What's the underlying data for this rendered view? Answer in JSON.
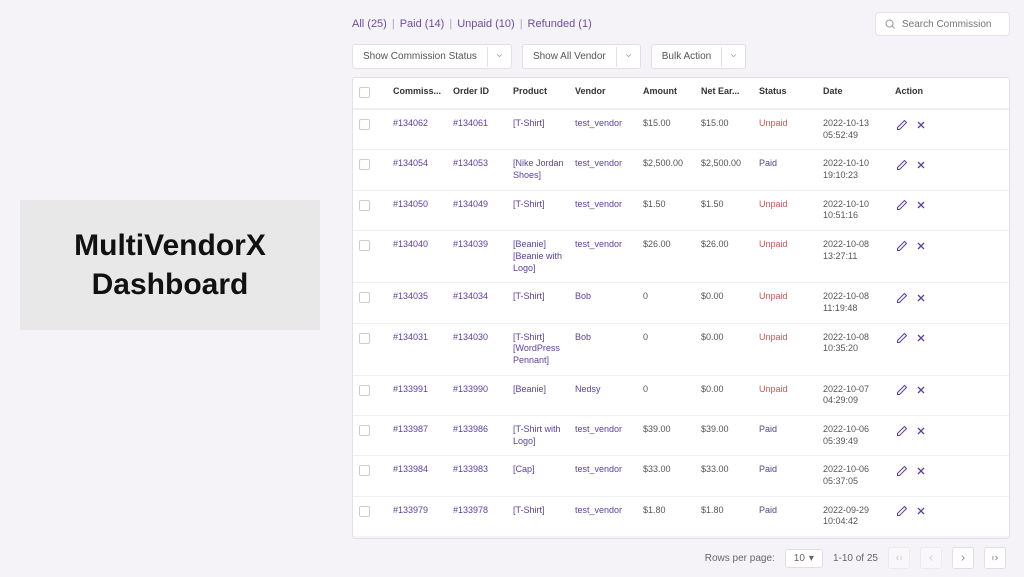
{
  "side_title": "MultiVendorX Dashboard",
  "topnav": {
    "all": "All (25)",
    "paid": "Paid (14)",
    "unpaid": "Unpaid (10)",
    "refunded": "Refunded (1)"
  },
  "search_placeholder": "Search Commission",
  "filters": {
    "status": "Show Commission Status",
    "vendor": "Show All Vendor",
    "bulk": "Bulk Action"
  },
  "columns": {
    "commission": "Commiss...",
    "order_id": "Order ID",
    "product": "Product",
    "vendor": "Vendor",
    "amount": "Amount",
    "net": "Net Ear...",
    "status": "Status",
    "date": "Date",
    "action": "Action"
  },
  "rows": [
    {
      "commission": "#134062",
      "order_id": "#134061",
      "product": "[T-Shirt]",
      "vendor": "test_vendor",
      "amount": "$15.00",
      "net": "$15.00",
      "status": "Unpaid",
      "status_class": "unpaid",
      "date": "2022-10-13 05:52:49"
    },
    {
      "commission": "#134054",
      "order_id": "#134053",
      "product": "[Nike Jordan Shoes]",
      "vendor": "test_vendor",
      "amount": "$2,500.00",
      "net": "$2,500.00",
      "status": "Paid",
      "status_class": "paid",
      "date": "2022-10-10 19:10:23"
    },
    {
      "commission": "#134050",
      "order_id": "#134049",
      "product": "[T-Shirt]",
      "vendor": "test_vendor",
      "amount": "$1.50",
      "net": "$1.50",
      "status": "Unpaid",
      "status_class": "unpaid",
      "date": "2022-10-10 10:51:16"
    },
    {
      "commission": "#134040",
      "order_id": "#134039",
      "product": "[Beanie] [Beanie with Logo]",
      "vendor": "test_vendor",
      "amount": "$26.00",
      "net": "$26.00",
      "status": "Unpaid",
      "status_class": "unpaid",
      "date": "2022-10-08 13:27:11"
    },
    {
      "commission": "#134035",
      "order_id": "#134034",
      "product": "[T-Shirt]",
      "vendor": "Bob",
      "amount": "0",
      "net": "$0.00",
      "status": "Unpaid",
      "status_class": "unpaid",
      "date": "2022-10-08 11:19:48"
    },
    {
      "commission": "#134031",
      "order_id": "#134030",
      "product": "[T-Shirt] [WordPress Pennant]",
      "vendor": "Bob",
      "amount": "0",
      "net": "$0.00",
      "status": "Unpaid",
      "status_class": "unpaid",
      "date": "2022-10-08 10:35:20"
    },
    {
      "commission": "#133991",
      "order_id": "#133990",
      "product": "[Beanie]",
      "vendor": "Nedsy",
      "amount": "0",
      "net": "$0.00",
      "status": "Unpaid",
      "status_class": "unpaid",
      "date": "2022-10-07 04:29:09"
    },
    {
      "commission": "#133987",
      "order_id": "#133986",
      "product": "[T-Shirt with Logo]",
      "vendor": "test_vendor",
      "amount": "$39.00",
      "net": "$39.00",
      "status": "Paid",
      "status_class": "paid",
      "date": "2022-10-06 05:39:49"
    },
    {
      "commission": "#133984",
      "order_id": "#133983",
      "product": "[Cap]",
      "vendor": "test_vendor",
      "amount": "$33.00",
      "net": "$33.00",
      "status": "Paid",
      "status_class": "paid",
      "date": "2022-10-06 05:37:05"
    },
    {
      "commission": "#133979",
      "order_id": "#133978",
      "product": "[T-Shirt]",
      "vendor": "test_vendor",
      "amount": "$1.80",
      "net": "$1.80",
      "status": "Paid",
      "status_class": "paid",
      "date": "2022-09-29 10:04:42"
    }
  ],
  "pager": {
    "rows_label": "Rows per page:",
    "rows_value": "10",
    "range": "1-10 of 25"
  }
}
